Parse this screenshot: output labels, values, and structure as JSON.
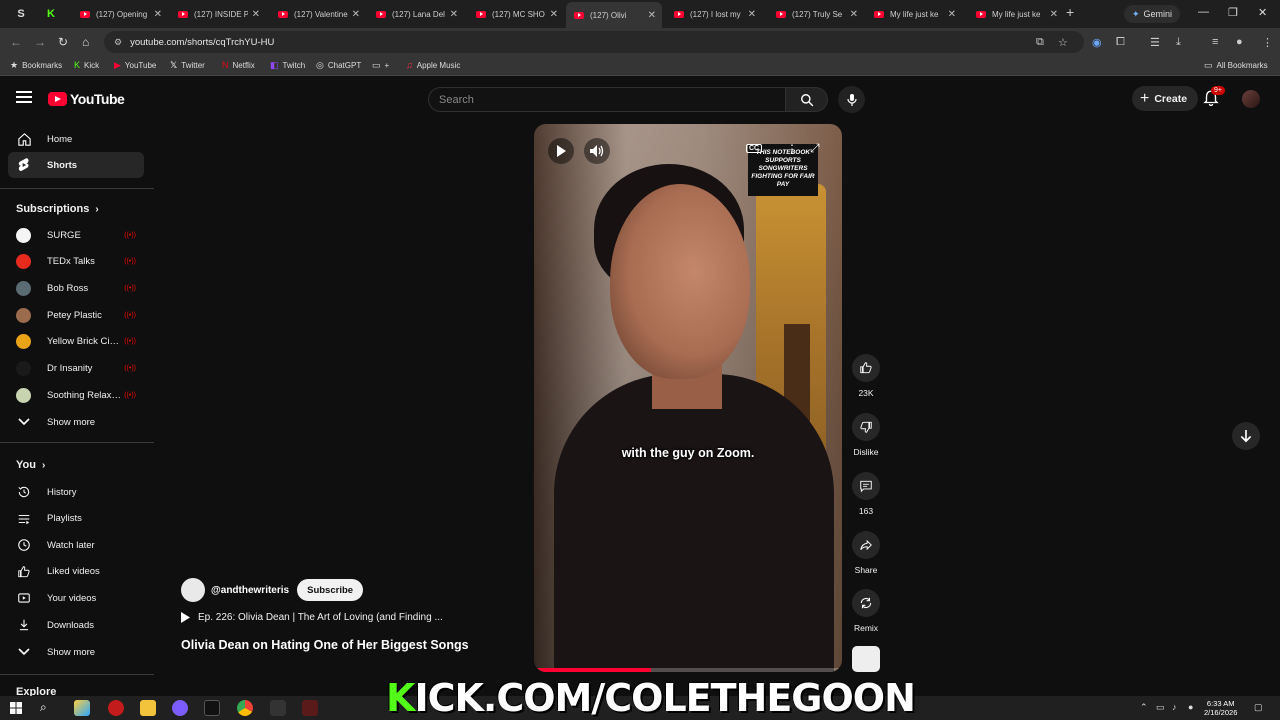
{
  "browser": {
    "tabs": [
      {
        "label": "(127) Opening"
      },
      {
        "label": "(127) INSIDE P"
      },
      {
        "label": "(127) Valentine"
      },
      {
        "label": "(127) Lana Del"
      },
      {
        "label": "(127) MC SHO"
      },
      {
        "label": "(127) Olivi",
        "active": true
      },
      {
        "label": "(127) I lost my"
      },
      {
        "label": "(127) Truly Se"
      },
      {
        "label": "My life just ke"
      },
      {
        "label": "My life just ke"
      }
    ],
    "gemini_label": "Gemini",
    "url": "youtube.com/shorts/cqTrchYU-HU",
    "bookmarks": [
      {
        "label": "Bookmarks",
        "icon": "star-icon"
      },
      {
        "label": "Kick",
        "icon": "kick-icon"
      },
      {
        "label": "YouTube",
        "icon": "youtube-icon"
      },
      {
        "label": "Twitter",
        "icon": "x-icon"
      },
      {
        "label": "Netflix",
        "icon": "netflix-icon"
      },
      {
        "label": "Twitch",
        "icon": "twitch-icon"
      },
      {
        "label": "ChatGPT",
        "icon": "chatgpt-icon"
      },
      {
        "label": "+",
        "icon": "folder-icon"
      },
      {
        "label": "Apple Music",
        "icon": "apple-music-icon"
      }
    ],
    "all_bookmarks": "All Bookmarks"
  },
  "header": {
    "logo_text": "YouTube",
    "search_placeholder": "Search",
    "create_label": "Create",
    "notification_count": "9+"
  },
  "sidebar": {
    "nav": [
      {
        "label": "Home",
        "icon": "home-icon"
      },
      {
        "label": "Shorts",
        "icon": "shorts-icon",
        "active": true
      }
    ],
    "subscriptions_title": "Subscriptions",
    "subscriptions": [
      {
        "label": "SURGE",
        "color": "#f5f5f5"
      },
      {
        "label": "TEDx Talks",
        "color": "#e62b1e"
      },
      {
        "label": "Bob Ross",
        "color": "#5a6b73"
      },
      {
        "label": "Petey Plastic",
        "color": "#9a6b4c"
      },
      {
        "label": "Yellow Brick Cine...",
        "color": "#e8a317"
      },
      {
        "label": "Dr Insanity",
        "color": "#1a1a1a"
      },
      {
        "label": "Soothing Relaxat...",
        "color": "#c8d4b0"
      }
    ],
    "show_more_1": "Show more",
    "you_title": "You",
    "you_items": [
      {
        "label": "History",
        "icon": "history-icon"
      },
      {
        "label": "Playlists",
        "icon": "playlists-icon"
      },
      {
        "label": "Watch later",
        "icon": "clock-icon"
      },
      {
        "label": "Liked videos",
        "icon": "thumbs-up-icon"
      },
      {
        "label": "Your videos",
        "icon": "video-icon"
      },
      {
        "label": "Downloads",
        "icon": "download-icon"
      }
    ],
    "show_more_2": "Show more",
    "explore_title": "Explore"
  },
  "video": {
    "caption": "with the guy on Zoom.",
    "sign_text": "THIS NOTEBOOK SUPPORTS SONGWRITERS FIGHTING FOR FAIR PAY",
    "cc_label": "CC",
    "progress": 0.38,
    "channel": "@andthewriteris",
    "subscribe_label": "Subscribe",
    "episode": "Ep. 226: Olivia Dean | The Art of Loving (and Finding ...",
    "title": "Olivia Dean on Hating One of Her Biggest Songs"
  },
  "actions": {
    "like_count": "23K",
    "dislike_label": "Dislike",
    "comment_count": "163",
    "share_label": "Share",
    "remix_label": "Remix"
  },
  "overlay": {
    "k": "K",
    "text": "ICK.COM/COLETHEGOON"
  },
  "taskbar": {
    "time": "6:33 AM",
    "date": "2/16/2026"
  }
}
